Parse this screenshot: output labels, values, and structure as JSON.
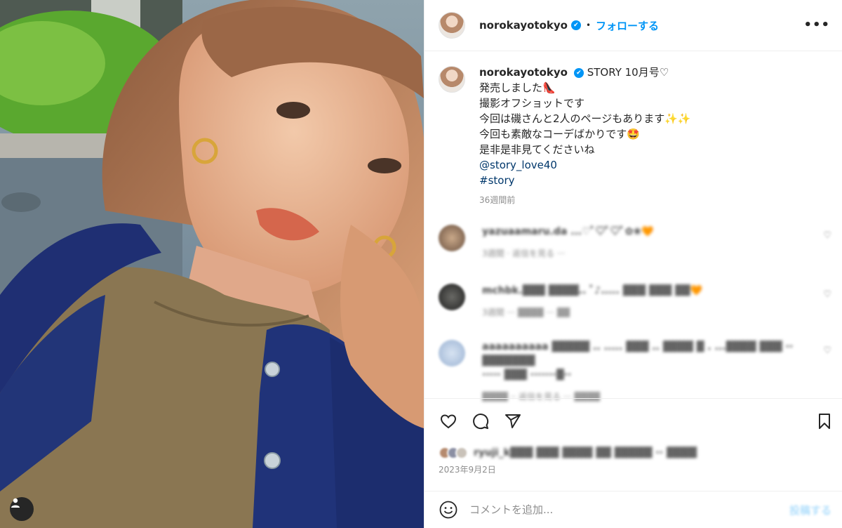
{
  "post": {
    "username": "norokayotokyo",
    "verified_mark": "✔",
    "separator": "•",
    "follow_label": "フォローする",
    "more_label": "•••",
    "caption": {
      "first_line": "STORY 10月号♡",
      "lines": [
        "発売しました👠",
        "撮影オフショットです",
        "今回は磯さんと2人のページもあります✨✨",
        "今回も素敵なコーデばかりです🤩",
        "是非是非見てくださいね"
      ],
      "mention": "@story_love40",
      "hashtag": "#story",
      "time_ago": "36週間前"
    },
    "comments": [
      {
        "text": "yazuaamaru.da ...♡ﾟ♡ﾟ♡ﾟ✿❀🧡",
        "meta": "3週間 ·  返信を見る  ···"
      },
      {
        "text": "mchbk.▓▓▓ ▓▓▓▓.. ﾞ♪..... ▓▓▓ ▓▓▓ ▓▓🧡",
        "meta": "3週間  ···  ▓▓▓▓  ··· ▓▓"
      },
      {
        "text": "aaaaaaaaaa ▓▓▓▓▓ .. ..... ▓▓▓ .. ▓▓▓▓ ▓ . ...▓▓▓▓ ▓▓▓ ·· ▓▓▓▓▓▓▓",
        "text2": "····· ▓▓▓ ·······▓··",
        "meta": "▓▓▓▓  ·· 返信を見る  ··· ▓▓▓▓"
      }
    ],
    "likes_text": "ryuji_k▓▓▓  ▓▓▓  ▓▓▓▓ ▓▓ ▓▓▓▓▓ ··  ▓▓▓▓",
    "date": "2023年9月2日",
    "comment_placeholder": "コメントを追加...",
    "post_label": "投稿する"
  },
  "icons": {
    "like": "heart-outline-icon",
    "comment": "comment-bubble-icon",
    "share": "paper-plane-icon",
    "save": "bookmark-icon",
    "emoji": "smiley-face-icon",
    "user_tag": "person-icon"
  },
  "colors": {
    "accent": "#0095f6",
    "link": "#00376b",
    "secondary_text": "#8e8e8e",
    "divider": "#efefef"
  }
}
